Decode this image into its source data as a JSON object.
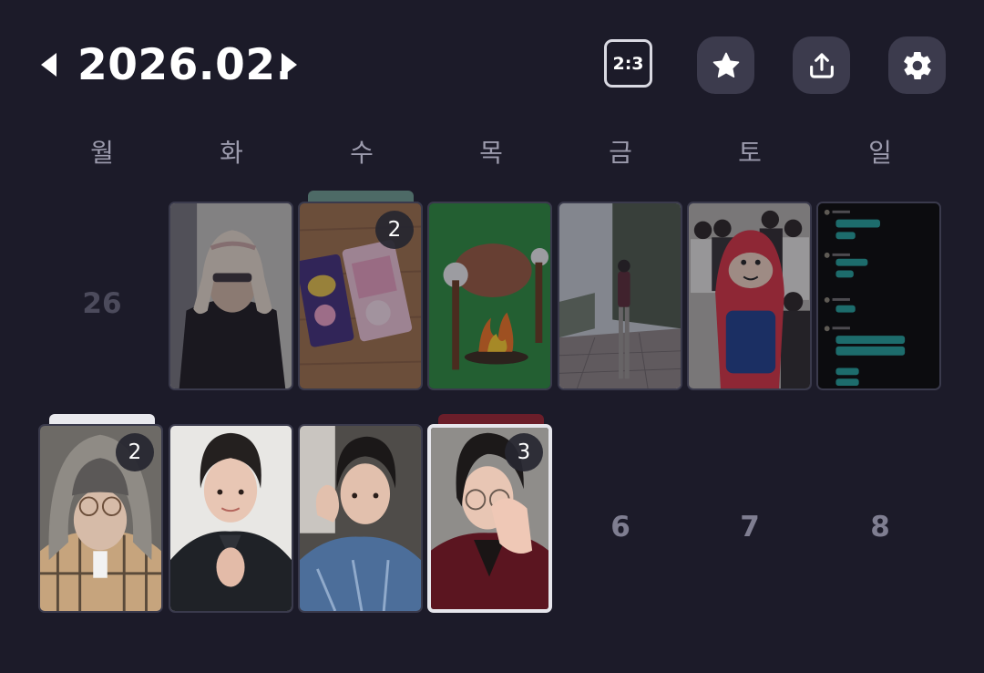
{
  "header": {
    "title": "2026.02.",
    "ratio_label": "2:3",
    "icons": {
      "prev": "caret-left-icon",
      "next": "caret-right-icon",
      "favorites": "star-icon",
      "share": "share-icon",
      "settings": "gear-icon"
    }
  },
  "weekdays": [
    "월",
    "화",
    "수",
    "목",
    "금",
    "토",
    "일"
  ],
  "week1": {
    "mon": "26",
    "tue_photo": "person with beige bucket hat",
    "wed_photo": "snack packages on wooden table",
    "wed_count": "2",
    "thu_photo": "cartoon campfire drawing",
    "fri_photo": "person standing on city street",
    "sat_photo": "group photo with red mascot",
    "sun_photo": "chat conversation screenshot"
  },
  "week2": {
    "mon_photo": "selfie with grey knit hood and glasses",
    "mon_count": "2",
    "tue_photo": "smiling portrait in black jacket",
    "wed_photo": "heart hand pose portrait",
    "thu_photo": "selfie with glasses, hand on face",
    "thu_count": "3",
    "fri": "6",
    "sat": "7",
    "sun": "8"
  },
  "colors": {
    "background": "#1c1b29",
    "button_bg": "#3c3b4d",
    "muted_text": "#9c9bad",
    "past_day_text": "#4c4b5c",
    "future_day_text": "#7f7e91",
    "selected_border": "#e6e6ec"
  }
}
